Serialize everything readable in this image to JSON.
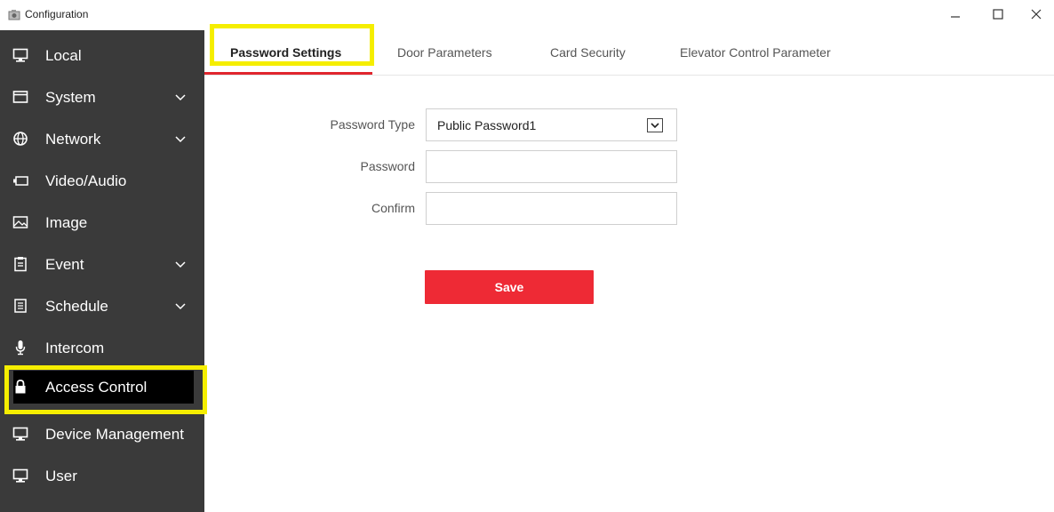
{
  "window": {
    "title": "Configuration",
    "minimize_glyph": "–",
    "maximize_glyph": "□",
    "close_glyph": "✕"
  },
  "sidebar": {
    "items": [
      {
        "label": "Local",
        "icon": "monitor-icon",
        "expandable": false
      },
      {
        "label": "System",
        "icon": "window-icon",
        "expandable": true
      },
      {
        "label": "Network",
        "icon": "globe-icon",
        "expandable": true
      },
      {
        "label": "Video/Audio",
        "icon": "camera-icon",
        "expandable": false
      },
      {
        "label": "Image",
        "icon": "image-icon",
        "expandable": false
      },
      {
        "label": "Event",
        "icon": "clipboard-icon",
        "expandable": true
      },
      {
        "label": "Schedule",
        "icon": "calendar-icon",
        "expandable": true
      },
      {
        "label": "Intercom",
        "icon": "microphone-icon",
        "expandable": false
      },
      {
        "label": "Access Control",
        "icon": "lock-icon",
        "expandable": false,
        "active": true
      },
      {
        "label": "Device Management",
        "icon": "monitor-icon",
        "expandable": false
      },
      {
        "label": "User",
        "icon": "monitor-icon",
        "expandable": false
      }
    ]
  },
  "tabs": [
    {
      "label": "Password Settings",
      "active": true
    },
    {
      "label": "Door Parameters"
    },
    {
      "label": "Card Security"
    },
    {
      "label": "Elevator Control Parameter"
    }
  ],
  "form": {
    "password_type_label": "Password Type",
    "password_type_value": "Public Password1",
    "password_label": "Password",
    "password_value": "",
    "confirm_label": "Confirm",
    "confirm_value": "",
    "save_label": "Save"
  },
  "colors": {
    "sidebar_bg": "#3a3a3a",
    "active_item_bg": "#000000",
    "accent_red": "#ee2a35",
    "highlight_yellow": "#f5ee00"
  }
}
